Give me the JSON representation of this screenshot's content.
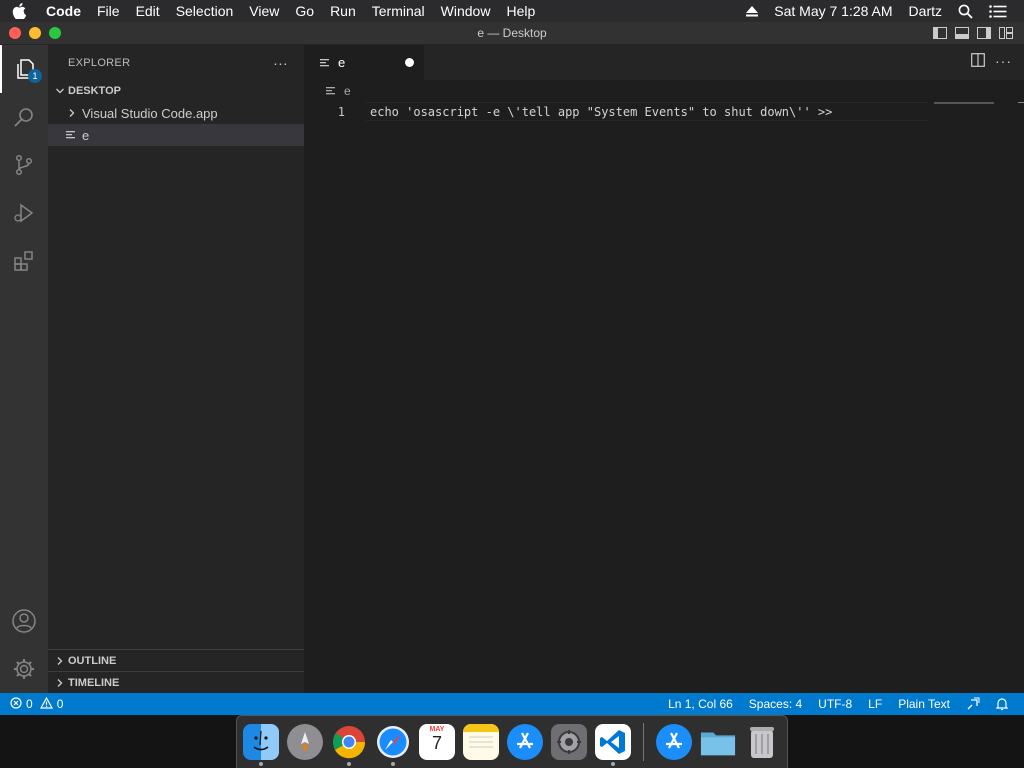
{
  "menubar": {
    "app_name": "Code",
    "menus": [
      "File",
      "Edit",
      "Selection",
      "View",
      "Go",
      "Run",
      "Terminal",
      "Window",
      "Help"
    ],
    "datetime": "Sat May 7  1:28 AM",
    "user": "Dartz",
    "icons": [
      "apple-icon",
      "eject-icon",
      "spotlight-search-icon",
      "control-center-list-icon"
    ]
  },
  "window": {
    "title": "e — Desktop"
  },
  "activity_bar": {
    "explorer_badge": "1",
    "items": [
      "explorer-icon",
      "search-icon",
      "source-control-icon",
      "run-debug-icon",
      "extensions-icon",
      "account-icon",
      "settings-gear-icon"
    ]
  },
  "sidebar": {
    "title": "EXPLORER",
    "more": "···",
    "section": "DESKTOP",
    "tree": [
      {
        "label": "Visual Studio Code.app",
        "kind": "folder"
      },
      {
        "label": "e",
        "kind": "file"
      }
    ],
    "bottom_sections": [
      "OUTLINE",
      "TIMELINE"
    ]
  },
  "editor": {
    "tab_label": "e",
    "breadcrumb": "e",
    "line_number": "1",
    "code": "echo 'osascript -e \\'tell app \"System Events\" to shut down\\'' >>"
  },
  "statusbar": {
    "errors": "0",
    "warnings": "0",
    "position": "Ln 1, Col 66",
    "spaces": "Spaces: 4",
    "encoding": "UTF-8",
    "eol": "LF",
    "language": "Plain Text"
  },
  "dock": {
    "apps": [
      "finder",
      "launchpad",
      "chrome",
      "safari",
      "calendar",
      "notes",
      "app-store",
      "system-preferences",
      "vscode",
      "app-store-downloads",
      "folder",
      "trash"
    ],
    "calendar_month": "MAY",
    "calendar_day": "7"
  },
  "colors": {
    "accent": "#007acc",
    "editor_bg": "#1e1e1e",
    "sidebar_bg": "#252526",
    "activity_bg": "#333333"
  }
}
